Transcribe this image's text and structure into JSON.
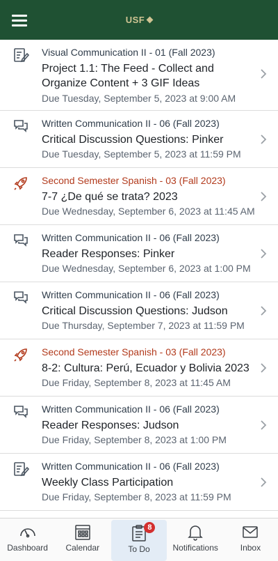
{
  "header": {
    "logo_text": "USF",
    "brand_color": "#1f5133",
    "logo_color": "#cfc493"
  },
  "items": [
    {
      "icon": "assignment-icon",
      "course": "Visual Communication II - 01 (Fall 2023)",
      "title": "Project 1.1: The Feed - Collect and Organize Content + 3 GIF Ideas",
      "due": "Due Tuesday, September 5, 2023 at 9:00 AM"
    },
    {
      "icon": "discussion-icon",
      "course": "Written Communication II - 06 (Fall 2023)",
      "title": "Critical Discussion Questions: Pinker",
      "due": "Due Tuesday, September 5, 2023 at 11:59 PM"
    },
    {
      "icon": "rocket-icon",
      "course": "Second Semester Spanish - 03 (Fall 2023)",
      "title": "7-7 ¿De qué se trata? 2023",
      "due": "Due Wednesday, September 6, 2023 at 11:45 AM"
    },
    {
      "icon": "discussion-icon",
      "course": "Written Communication II - 06 (Fall 2023)",
      "title": "Reader Responses: Pinker",
      "due": "Due Wednesday, September 6, 2023 at 1:00 PM"
    },
    {
      "icon": "discussion-icon",
      "course": "Written Communication II - 06 (Fall 2023)",
      "title": "Critical Discussion Questions: Judson",
      "due": "Due Thursday, September 7, 2023 at 11:59 PM"
    },
    {
      "icon": "rocket-icon",
      "course": "Second Semester Spanish - 03 (Fall 2023)",
      "title": "8-2: Cultura: Perú, Ecuador y Bolivia 2023",
      "due": "Due Friday, September 8, 2023 at 11:45 AM"
    },
    {
      "icon": "discussion-icon",
      "course": "Written Communication II - 06 (Fall 2023)",
      "title": "Reader Responses: Judson",
      "due": "Due Friday, September 8, 2023 at 1:00 PM"
    },
    {
      "icon": "assignment-icon",
      "course": "Written Communication II - 06 (Fall 2023)",
      "title": "Weekly Class Participation",
      "due": "Due Friday, September 8, 2023 at 11:59 PM"
    }
  ],
  "tabs": [
    {
      "label": "Dashboard",
      "icon": "dashboard-icon"
    },
    {
      "label": "Calendar",
      "icon": "calendar-icon"
    },
    {
      "label": "To Do",
      "icon": "todo-icon",
      "badge": "8",
      "active": true
    },
    {
      "label": "Notifications",
      "icon": "bell-icon"
    },
    {
      "label": "Inbox",
      "icon": "inbox-icon"
    }
  ],
  "colors": {
    "spanish_course": "#b23a1c",
    "badge": "#d32f2f",
    "active_tab": "#e3ecf6"
  }
}
